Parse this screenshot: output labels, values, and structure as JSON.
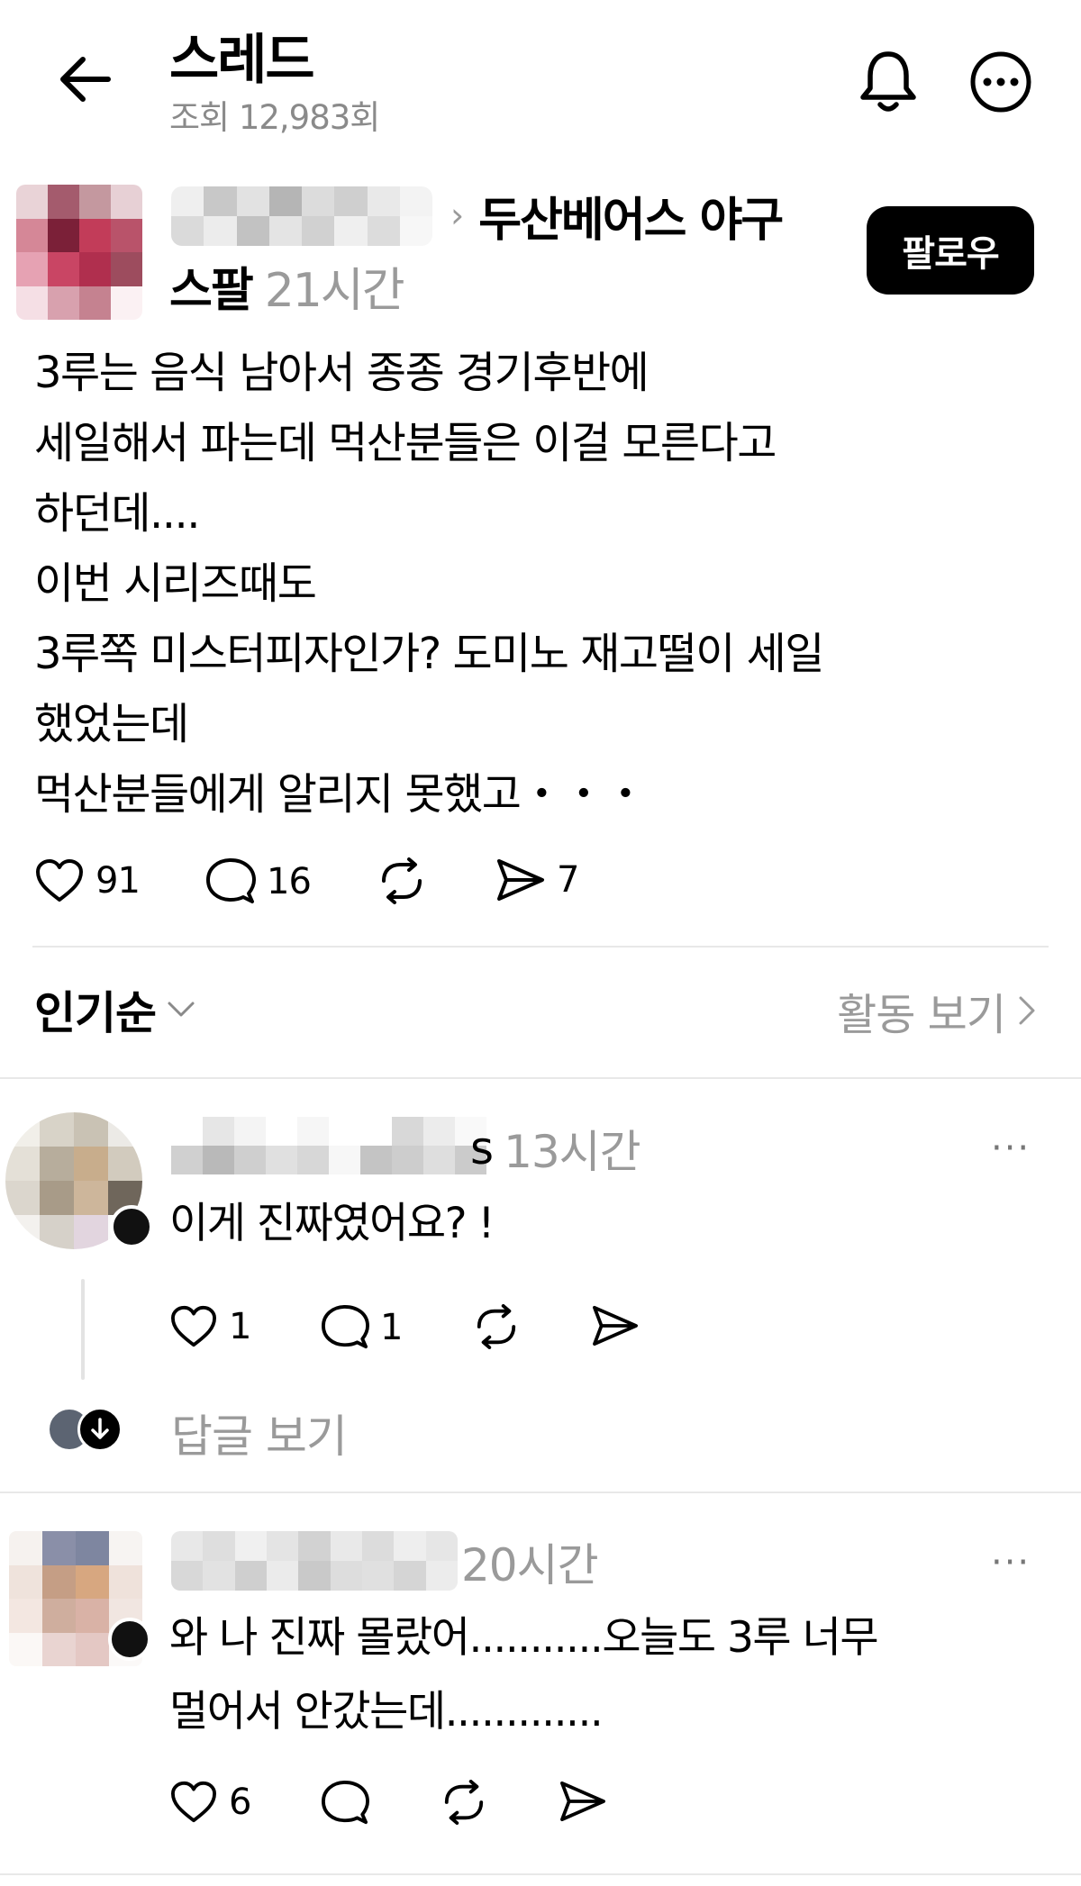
{
  "header": {
    "title": "스레드",
    "views": "조회 12,983회",
    "icons": {
      "back": "arrow-left-icon",
      "notify": "bell-icon",
      "more": "more-circle-icon"
    }
  },
  "post": {
    "community": "두산베어스 야구",
    "community_suffix": "스팔",
    "time": "21시간",
    "follow_label": "팔로우",
    "lines": [
      "3루는 음식 남아서 종종 경기후반에",
      "세일해서 파는데 먹산분들은 이걸 모른다고",
      "하던데....",
      "이번 시리즈때도",
      "3루쪽 미스터피자인가?  도미노 재고떨이 세일",
      "했었는데",
      "먹산분들에게 알리지 못했고・・・"
    ],
    "likes": "91",
    "comments": "16",
    "shares": "7"
  },
  "sort": {
    "label": "인기순",
    "activity_label": "활동 보기"
  },
  "comments": [
    {
      "username_tail": "s",
      "time": "13시간",
      "lines": [
        "이게 진짜였어요? !"
      ],
      "likes": "1",
      "replies": "1",
      "more": "···",
      "see_replies": "답글 보기"
    },
    {
      "username_tail": "",
      "time": "20시간",
      "lines": [
        "와 나 진짜 몰랐어...........오늘도 3루 너무",
        "멀어서 안갔는데............."
      ],
      "likes": "6",
      "more": "···"
    }
  ],
  "colors": {
    "text": "#000000",
    "muted": "#9a9a9a",
    "divider": "#e8e8e8",
    "button": "#000000"
  }
}
